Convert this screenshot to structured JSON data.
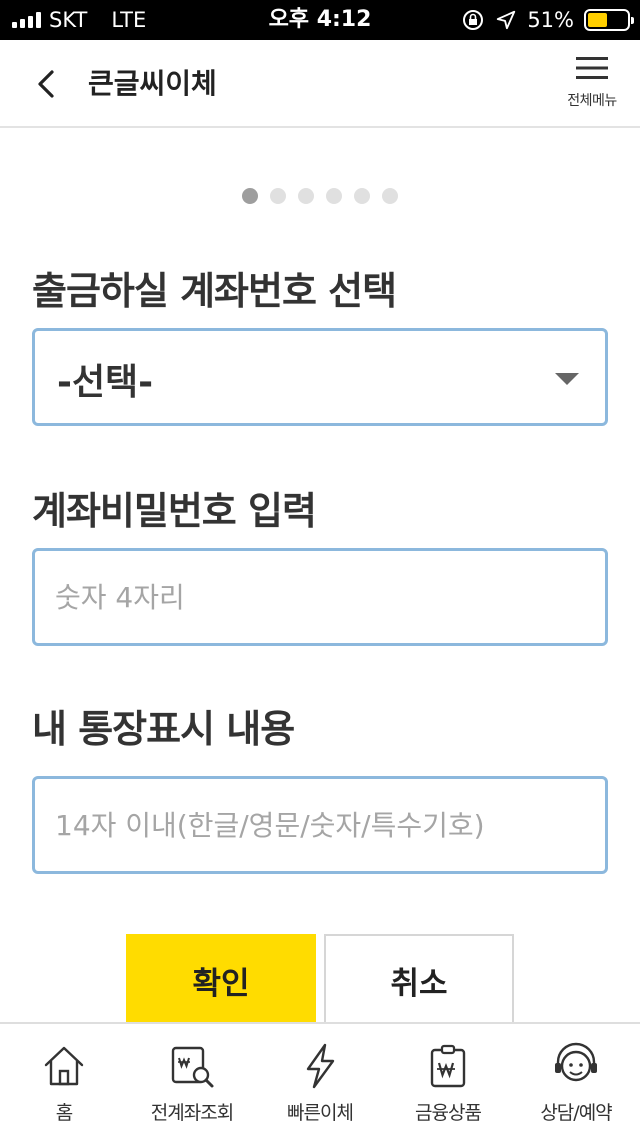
{
  "status_bar": {
    "carrier": "SKT",
    "network": "LTE",
    "time": "오후 4:12",
    "battery_percent": "51%",
    "battery_level": 0.51,
    "battery_color": "#ffcf00"
  },
  "header": {
    "title": "큰글씨이체",
    "menu_label": "전체메뉴"
  },
  "indicator": {
    "total_steps": 6,
    "current_step": 1
  },
  "form": {
    "account_label": "출금하실 계좌번호 선택",
    "account_select_value": "-선택-",
    "password_label": "계좌비밀번호 입력",
    "password_placeholder": "숫자 4자리",
    "memo_label": "내 통장표시 내용",
    "memo_placeholder": "14자 이내(한글/영문/숫자/특수기호)"
  },
  "buttons": {
    "confirm": "확인",
    "cancel": "취소"
  },
  "bottom_nav": {
    "items": [
      {
        "label": "홈",
        "icon": "home-icon"
      },
      {
        "label": "전계좌조회",
        "icon": "account-search-icon"
      },
      {
        "label": "빠른이체",
        "icon": "lightning-icon"
      },
      {
        "label": "금융상품",
        "icon": "financial-product-icon"
      },
      {
        "label": "상담/예약",
        "icon": "consultation-icon"
      }
    ]
  },
  "colors": {
    "accent": "#ffdc00",
    "field_border": "#8cb8dd"
  }
}
